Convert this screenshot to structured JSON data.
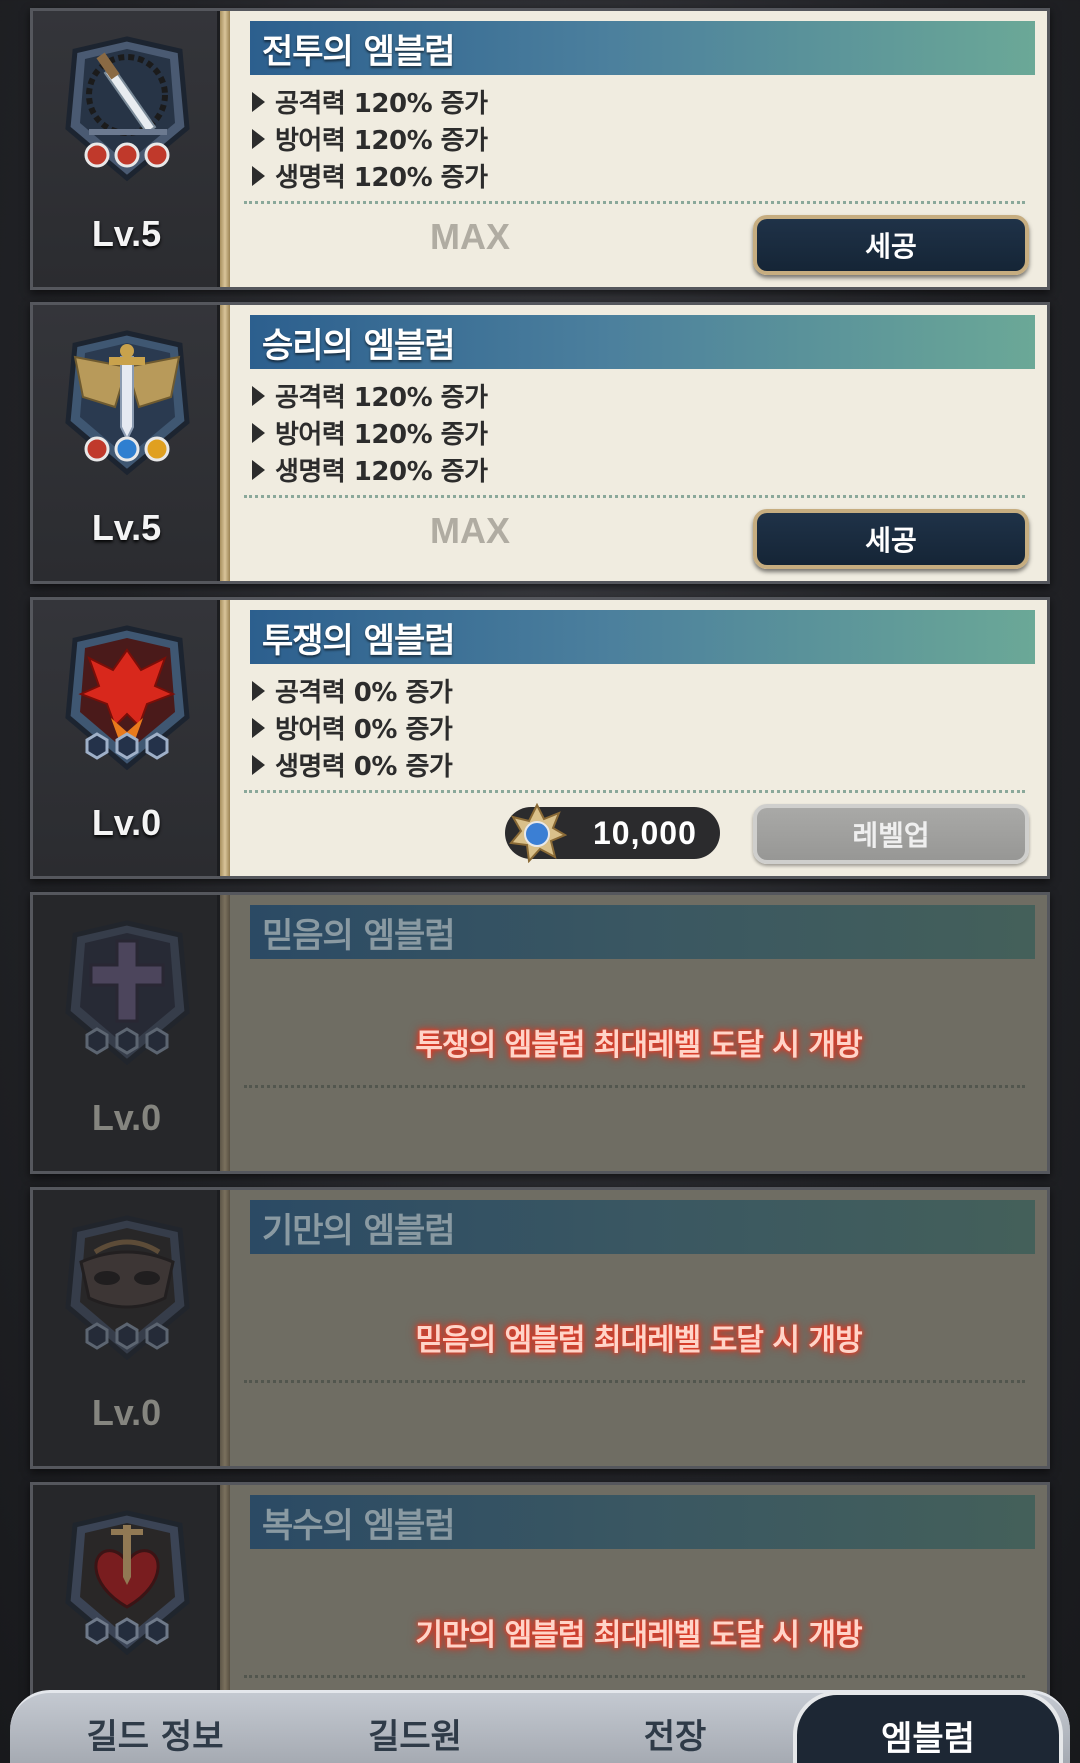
{
  "emblems": [
    {
      "title": "전투의 엠블럼",
      "level": "Lv.5",
      "stats": [
        "공격력 120% 증가",
        "방어력 120% 증가",
        "생명력 120% 증가"
      ],
      "max_label": "MAX",
      "button": "세공",
      "icon": "sword-emblem-icon",
      "gems": [
        "red",
        "red",
        "red"
      ]
    },
    {
      "title": "승리의 엠블럼",
      "level": "Lv.5",
      "stats": [
        "공격력 120% 증가",
        "방어력 120% 증가",
        "생명력 120% 증가"
      ],
      "max_label": "MAX",
      "button": "세공",
      "icon": "winged-sword-emblem-icon",
      "gems": [
        "red",
        "blue",
        "yellow"
      ]
    },
    {
      "title": "투쟁의 엠블럼",
      "level": "Lv.0",
      "stats": [
        "공격력 0% 증가",
        "방어력 0% 증가",
        "생명력 0% 증가"
      ],
      "cost": "10,000",
      "button": "레벨업",
      "icon": "dragon-emblem-icon"
    },
    {
      "title": "믿음의 엠블럼",
      "level": "Lv.0",
      "locked_message": "투쟁의 엠블럼 최대레벨 도달 시 개방",
      "icon": "cross-emblem-icon"
    },
    {
      "title": "기만의 엠블럼",
      "level": "Lv.0",
      "locked_message": "믿음의 엠블럼 최대레벨 도달 시 개방",
      "icon": "mask-emblem-icon"
    },
    {
      "title": "복수의 엠블럼",
      "locked_message": "기만의 엠블럼 최대레벨 도달 시 개방",
      "icon": "heart-dagger-emblem-icon"
    }
  ],
  "tabs": [
    "길드 정보",
    "길드원",
    "전장",
    "엠블럼"
  ],
  "active_tab": "엠블럼"
}
